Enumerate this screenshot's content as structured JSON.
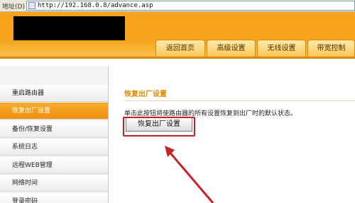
{
  "address_bar": {
    "label": "地址(D)",
    "url": "http://192.168.0.8/advance.asp"
  },
  "header": {
    "tabs": [
      "返回首页",
      "高级设置",
      "无线设置",
      "带宽控制"
    ]
  },
  "sidebar": {
    "items": [
      {
        "label": "重启路由器"
      },
      {
        "label": "恢复出厂设置",
        "active": true
      },
      {
        "label": "备份/恢复设置"
      },
      {
        "label": "系统日志"
      },
      {
        "label": "远程WEB管理"
      },
      {
        "label": "网络时间"
      },
      {
        "label": "登录密码"
      }
    ]
  },
  "main": {
    "section_title": "恢复出厂设置",
    "description": "单击此按钮将使路由器的所有设置恢复到出厂时的默认状态。",
    "restore_button_label": "恢复出厂设置"
  },
  "colors": {
    "header_orange": "#f7a21b",
    "active_item": "#f19613",
    "highlight_red": "#c8202a"
  }
}
